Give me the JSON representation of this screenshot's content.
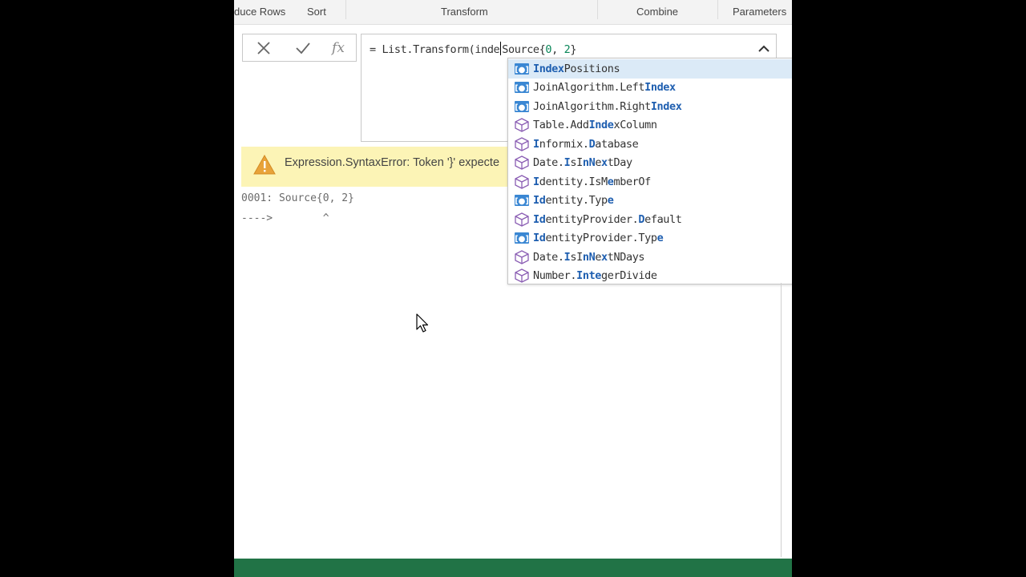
{
  "ribbon": {
    "groups": [
      {
        "label": "duce Rows"
      },
      {
        "label": "Sort"
      },
      {
        "label": "Transform"
      },
      {
        "label": "Combine"
      },
      {
        "label": "Parameters"
      }
    ]
  },
  "formula_bar": {
    "cancel_icon": "close-icon",
    "commit_icon": "check-icon",
    "fx_label": "fx",
    "text_before_caret": "= List.Transform(inde",
    "text_after_caret_a": "Source{",
    "num_a": "0",
    "sep": ", ",
    "num_b": "2",
    "text_end": "}"
  },
  "error": {
    "message": "Expression.SyntaxError: Token '}' expecte",
    "line1": "0001: Source{0, 2}",
    "line2": "---->        ^"
  },
  "autocomplete": {
    "items": [
      {
        "icon": "value-icon",
        "pre": "",
        "match": "Index",
        "post": "Positions",
        "selected": true
      },
      {
        "icon": "value-icon",
        "pre": "JoinAlgorithm.Left",
        "match": "Index",
        "post": "",
        "selected": false
      },
      {
        "icon": "value-icon",
        "pre": "JoinAlgorithm.Right",
        "match": "Index",
        "post": "",
        "selected": false
      },
      {
        "icon": "function-icon",
        "pre": "Table.Add",
        "match": "Inde",
        "post": "xColumn",
        "selected": false
      },
      {
        "icon": "function-icon",
        "pre": "",
        "match": "I",
        "post": "nformix.",
        "match2": "D",
        "post2": "atabase",
        "selected": false
      },
      {
        "icon": "function-icon",
        "pre": "Date.",
        "match": "I",
        "post": "sI",
        "match2": "nN",
        "post2": "e",
        "match3": "x",
        "post3": "tDay",
        "selected": false
      },
      {
        "icon": "function-icon",
        "pre": "",
        "match": "I",
        "post": "dentity.IsM",
        "match2": "e",
        "post2": "mberOf",
        "selected": false
      },
      {
        "icon": "value-icon",
        "pre": "",
        "match": "Id",
        "post": "entity.Typ",
        "match2": "e",
        "post2": "",
        "selected": false
      },
      {
        "icon": "function-icon",
        "pre": "",
        "match": "Id",
        "post": "entityProvider.",
        "match2": "D",
        "post2": "efault",
        "selected": false
      },
      {
        "icon": "value-icon",
        "pre": "",
        "match": "Id",
        "post": "entityProvider.Typ",
        "match2": "e",
        "post2": "",
        "selected": false
      },
      {
        "icon": "function-icon",
        "pre": "Date.",
        "match": "I",
        "post": "sI",
        "match2": "nN",
        "post2": "e",
        "match3": "x",
        "post3": "tNDays",
        "selected": false
      },
      {
        "icon": "function-icon",
        "pre": "Number.",
        "match": "I",
        "post": "",
        "match2": "nte",
        "post2": "gerDivide",
        "selected": false
      }
    ]
  },
  "colors": {
    "status_bar": "#217346",
    "error_bg": "#fcf4b6",
    "selected_item": "#dbeaf7",
    "match_text": "#1f5fb0"
  }
}
